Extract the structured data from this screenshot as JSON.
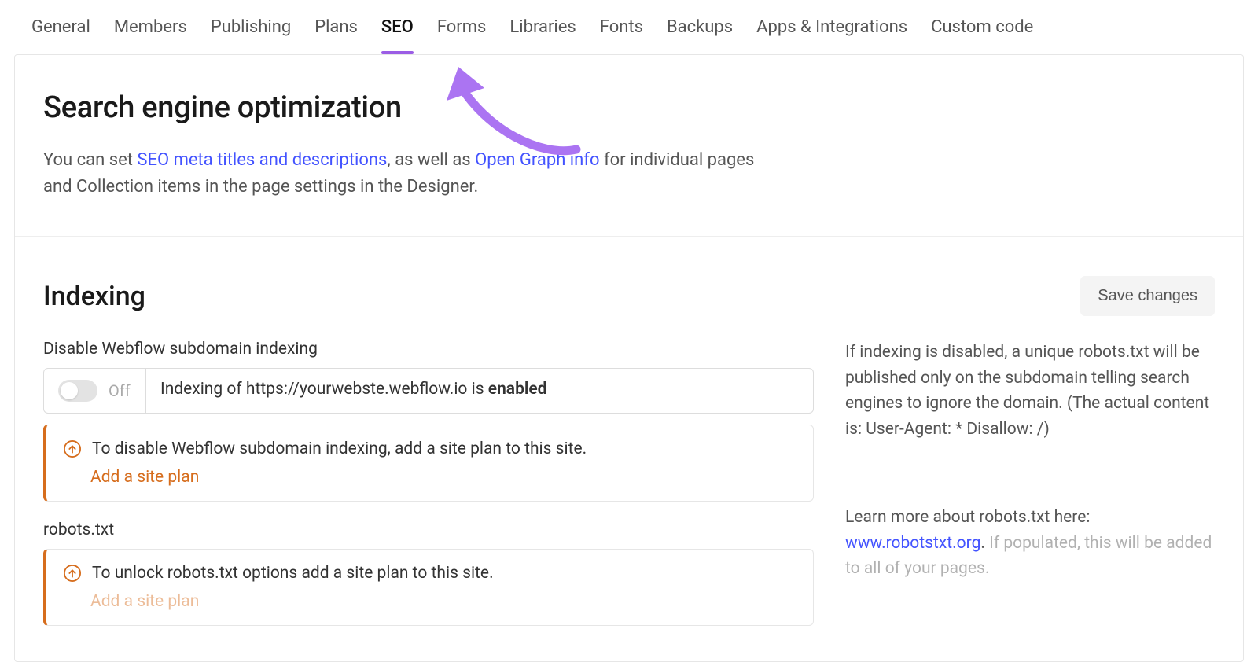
{
  "tabs": {
    "general": "General",
    "members": "Members",
    "publishing": "Publishing",
    "plans": "Plans",
    "seo": "SEO",
    "forms": "Forms",
    "libraries": "Libraries",
    "fonts": "Fonts",
    "backups": "Backups",
    "apps_integrations": "Apps & Integrations",
    "custom_code": "Custom code"
  },
  "seo_section": {
    "title": "Search engine optimization",
    "desc_prefix": "You can set ",
    "link1": "SEO meta titles and descriptions",
    "desc_mid": ", as well as ",
    "link2": "Open Graph info",
    "desc_suffix": " for individual pages and Collection items in the page settings in the Designer."
  },
  "indexing": {
    "title": "Indexing",
    "save_label": "Save changes",
    "disable_label": "Disable Webflow subdomain indexing",
    "toggle_state": "Off",
    "toggle_text_prefix": "Indexing of https://yourwebste.webflow.io is ",
    "toggle_text_status": "enabled",
    "warn1_text": "To disable Webflow subdomain indexing, add a site plan to this site.",
    "warn1_link": "Add a site plan",
    "robots_label": "robots.txt",
    "warn2_text": "To unlock robots.txt options add a site plan to this site.",
    "warn2_link": "Add a site plan",
    "info1": "If indexing is disabled, a unique robots.txt will be published only on the subdomain telling search engines to ignore the domain. (The actual content is: User-Agent: * Disallow: /)",
    "info2_prefix": "Learn more about robots.txt here: ",
    "info2_link": "www.robotstxt.org",
    "info2_suffix_dots": ". ",
    "info2_suffix_fade": "If populated, this will be added to all of your pages."
  }
}
